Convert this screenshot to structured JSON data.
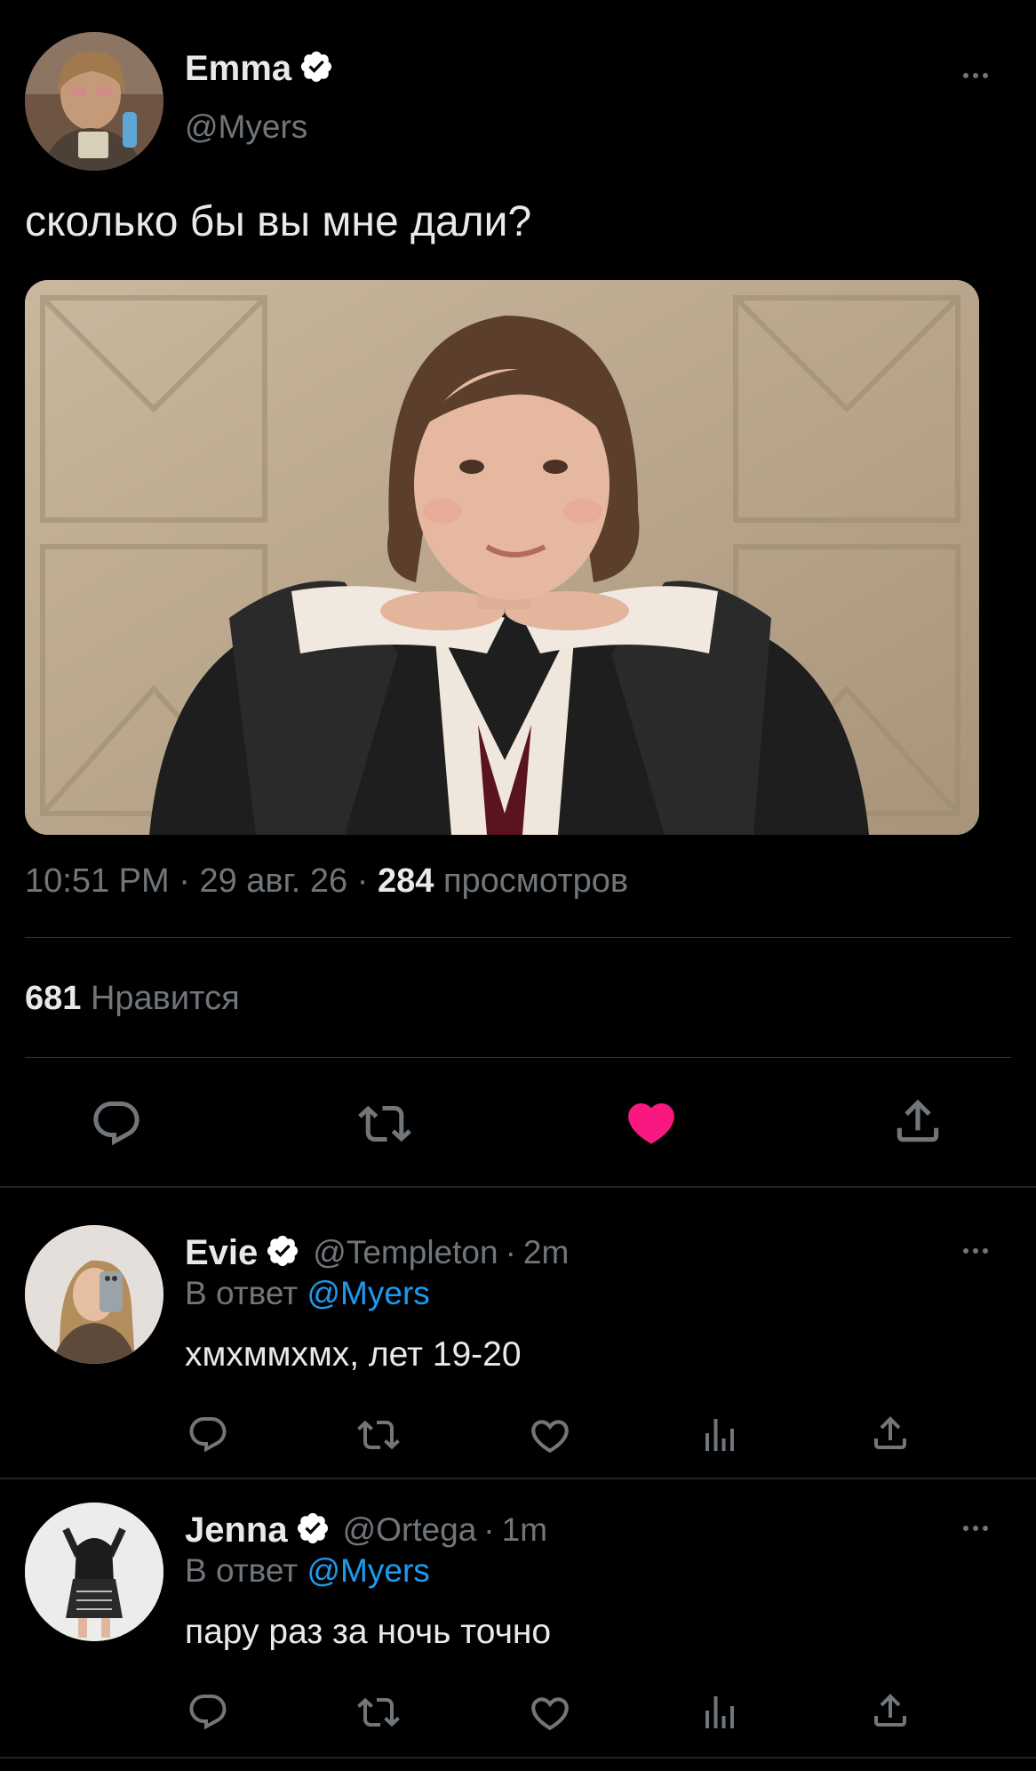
{
  "main_tweet": {
    "author_name": "Emma",
    "author_handle": "@Myers",
    "text": "сколько бы вы мне дали?",
    "time": "10:51 PM",
    "date": "29 авг. 26",
    "views_count": "284",
    "views_label": "просмотров",
    "likes_count": "681",
    "likes_label": "Нравится",
    "separator": "·",
    "liked": true,
    "like_color": "#f91880"
  },
  "replies": [
    {
      "author_name": "Evie",
      "author_handle": "@Templeton",
      "time": "2m",
      "reply_prefix": "В ответ",
      "reply_to": "@Myers",
      "text": "хмхммхмх, лет 19-20"
    },
    {
      "author_name": "Jenna",
      "author_handle": "@Ortega",
      "time": "1m",
      "reply_prefix": "В ответ",
      "reply_to": "@Myers",
      "text": "пару раз за ночь точно"
    }
  ],
  "colors": {
    "background": "#000000",
    "text": "#e7e9ea",
    "muted": "#71767b",
    "link": "#1d9bf0",
    "verified": "#ffffff"
  },
  "icons": [
    "verified-badge-icon",
    "more-options-icon",
    "reply-icon",
    "retweet-icon",
    "like-icon",
    "views-icon",
    "share-icon"
  ]
}
